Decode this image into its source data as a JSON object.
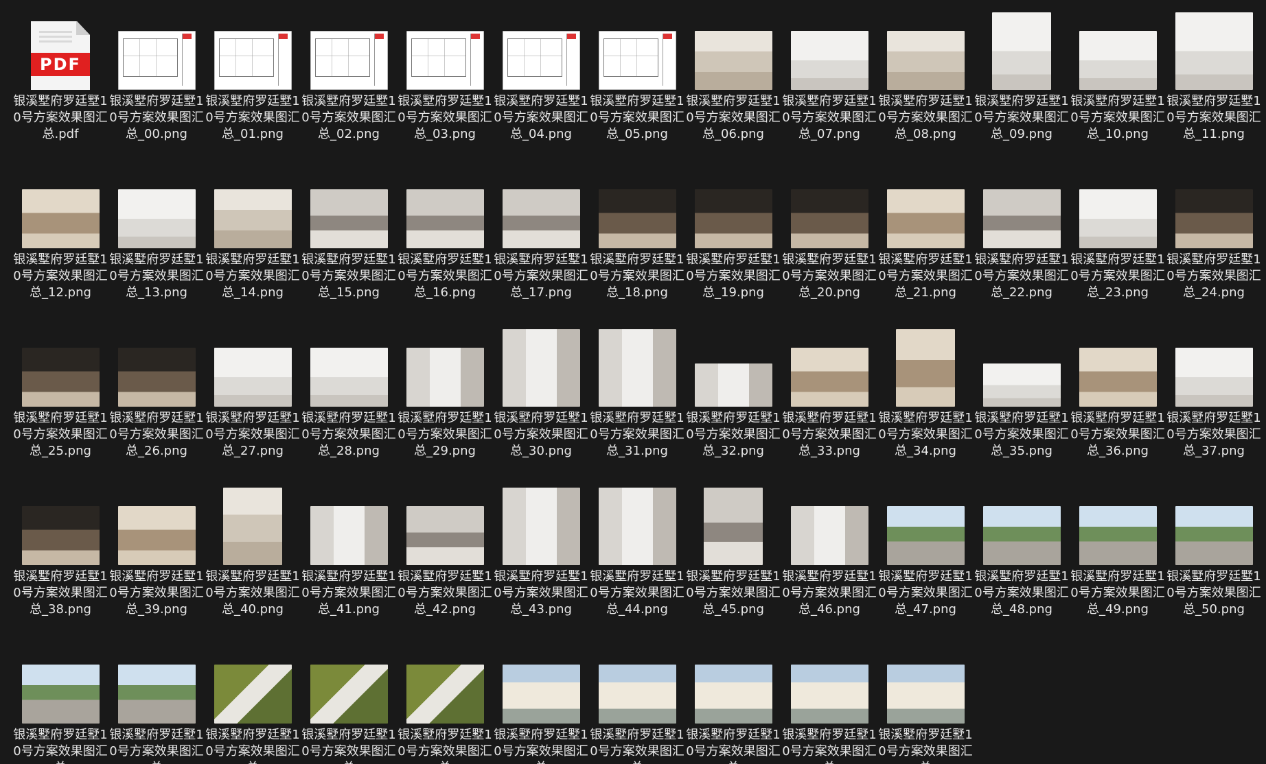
{
  "files": [
    {
      "label": "银溪墅府罗廷墅10号方案效果图汇总.pdf",
      "kind": "pdf",
      "icon": "pdf-file-icon",
      "icon_text": "PDF"
    },
    {
      "label": "银溪墅府罗廷墅10号方案效果图汇总_00.png",
      "kind": "plan"
    },
    {
      "label": "银溪墅府罗廷墅10号方案效果图汇总_01.png",
      "kind": "plan"
    },
    {
      "label": "银溪墅府罗廷墅10号方案效果图汇总_02.png",
      "kind": "plan"
    },
    {
      "label": "银溪墅府罗廷墅10号方案效果图汇总_03.png",
      "kind": "plan"
    },
    {
      "label": "银溪墅府罗廷墅10号方案效果图汇总_04.png",
      "kind": "plan"
    },
    {
      "label": "银溪墅府罗廷墅10号方案效果图汇总_05.png",
      "kind": "plan"
    },
    {
      "label": "银溪墅府罗廷墅10号方案效果图汇总_06.png",
      "kind": "int-beige"
    },
    {
      "label": "银溪墅府罗廷墅10号方案效果图汇总_07.png",
      "kind": "int-white"
    },
    {
      "label": "银溪墅府罗廷墅10号方案效果图汇总_08.png",
      "kind": "int-beige"
    },
    {
      "label": "银溪墅府罗廷墅10号方案效果图汇总_09.png",
      "kind": "int-white"
    },
    {
      "label": "银溪墅府罗廷墅10号方案效果图汇总_10.png",
      "kind": "int-white"
    },
    {
      "label": "银溪墅府罗廷墅10号方案效果图汇总_11.png",
      "kind": "int-white"
    },
    {
      "label": "银溪墅府罗廷墅10号方案效果图汇总_12.png",
      "kind": "int-warm"
    },
    {
      "label": "银溪墅府罗廷墅10号方案效果图汇总_13.png",
      "kind": "int-white"
    },
    {
      "label": "银溪墅府罗廷墅10号方案效果图汇总_14.png",
      "kind": "int-beige"
    },
    {
      "label": "银溪墅府罗廷墅10号方案效果图汇总_15.png",
      "kind": "int-grey"
    },
    {
      "label": "银溪墅府罗廷墅10号方案效果图汇总_16.png",
      "kind": "int-grey"
    },
    {
      "label": "银溪墅府罗廷墅10号方案效果图汇总_17.png",
      "kind": "int-grey"
    },
    {
      "label": "银溪墅府罗廷墅10号方案效果图汇总_18.png",
      "kind": "int-dark"
    },
    {
      "label": "银溪墅府罗廷墅10号方案效果图汇总_19.png",
      "kind": "int-dark"
    },
    {
      "label": "银溪墅府罗廷墅10号方案效果图汇总_20.png",
      "kind": "int-dark"
    },
    {
      "label": "银溪墅府罗廷墅10号方案效果图汇总_21.png",
      "kind": "int-warm"
    },
    {
      "label": "银溪墅府罗廷墅10号方案效果图汇总_22.png",
      "kind": "int-grey"
    },
    {
      "label": "银溪墅府罗廷墅10号方案效果图汇总_23.png",
      "kind": "int-white"
    },
    {
      "label": "银溪墅府罗廷墅10号方案效果图汇总_24.png",
      "kind": "int-dark"
    },
    {
      "label": "银溪墅府罗廷墅10号方案效果图汇总_25.png",
      "kind": "int-dark"
    },
    {
      "label": "银溪墅府罗廷墅10号方案效果图汇总_26.png",
      "kind": "int-dark"
    },
    {
      "label": "银溪墅府罗廷墅10号方案效果图汇总_27.png",
      "kind": "int-white"
    },
    {
      "label": "银溪墅府罗廷墅10号方案效果图汇总_28.png",
      "kind": "int-white"
    },
    {
      "label": "银溪墅府罗廷墅10号方案效果图汇总_29.png",
      "kind": "int-bath"
    },
    {
      "label": "银溪墅府罗廷墅10号方案效果图汇总_30.png",
      "kind": "int-bath"
    },
    {
      "label": "银溪墅府罗廷墅10号方案效果图汇总_31.png",
      "kind": "int-bath"
    },
    {
      "label": "银溪墅府罗廷墅10号方案效果图汇总_32.png",
      "kind": "int-bath"
    },
    {
      "label": "银溪墅府罗廷墅10号方案效果图汇总_33.png",
      "kind": "int-warm"
    },
    {
      "label": "银溪墅府罗廷墅10号方案效果图汇总_34.png",
      "kind": "int-warm"
    },
    {
      "label": "银溪墅府罗廷墅10号方案效果图汇总_35.png",
      "kind": "int-white"
    },
    {
      "label": "银溪墅府罗廷墅10号方案效果图汇总_36.png",
      "kind": "int-warm"
    },
    {
      "label": "银溪墅府罗廷墅10号方案效果图汇总_37.png",
      "kind": "int-white"
    },
    {
      "label": "银溪墅府罗廷墅10号方案效果图汇总_38.png",
      "kind": "int-dark"
    },
    {
      "label": "银溪墅府罗廷墅10号方案效果图汇总_39.png",
      "kind": "int-warm"
    },
    {
      "label": "银溪墅府罗廷墅10号方案效果图汇总_40.png",
      "kind": "int-beige"
    },
    {
      "label": "银溪墅府罗廷墅10号方案效果图汇总_41.png",
      "kind": "int-bath"
    },
    {
      "label": "银溪墅府罗廷墅10号方案效果图汇总_42.png",
      "kind": "int-grey"
    },
    {
      "label": "银溪墅府罗廷墅10号方案效果图汇总_43.png",
      "kind": "int-bath"
    },
    {
      "label": "银溪墅府罗廷墅10号方案效果图汇总_44.png",
      "kind": "int-bath"
    },
    {
      "label": "银溪墅府罗廷墅10号方案效果图汇总_45.png",
      "kind": "int-grey"
    },
    {
      "label": "银溪墅府罗廷墅10号方案效果图汇总_46.png",
      "kind": "int-bath"
    },
    {
      "label": "银溪墅府罗廷墅10号方案效果图汇总_47.png",
      "kind": "ext-garden"
    },
    {
      "label": "银溪墅府罗廷墅10号方案效果图汇总_48.png",
      "kind": "ext-garden"
    },
    {
      "label": "银溪墅府罗廷墅10号方案效果图汇总_49.png",
      "kind": "ext-garden"
    },
    {
      "label": "银溪墅府罗廷墅10号方案效果图汇总_50.png",
      "kind": "ext-garden"
    },
    {
      "label": "银溪墅府罗廷墅10号方案效果图汇总",
      "kind": "ext-garden"
    },
    {
      "label": "银溪墅府罗廷墅10号方案效果图汇总",
      "kind": "ext-garden"
    },
    {
      "label": "银溪墅府罗廷墅10号方案效果图汇总",
      "kind": "ext-aerial"
    },
    {
      "label": "银溪墅府罗廷墅10号方案效果图汇总",
      "kind": "ext-aerial"
    },
    {
      "label": "银溪墅府罗廷墅10号方案效果图汇总",
      "kind": "ext-aerial"
    },
    {
      "label": "银溪墅府罗廷墅10号方案效果图汇总",
      "kind": "ext-villa"
    },
    {
      "label": "银溪墅府罗廷墅10号方案效果图汇总",
      "kind": "ext-villa"
    },
    {
      "label": "银溪墅府罗廷墅10号方案效果图汇总",
      "kind": "ext-villa"
    },
    {
      "label": "银溪墅府罗廷墅10号方案效果图汇总",
      "kind": "ext-villa"
    },
    {
      "label": "银溪墅府罗廷墅10号方案效果图汇总",
      "kind": "ext-villa"
    }
  ]
}
